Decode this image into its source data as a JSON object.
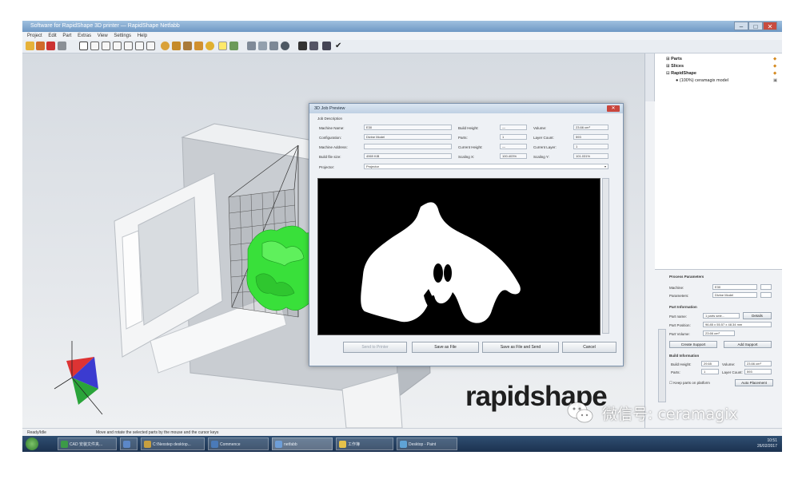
{
  "window": {
    "title": "Software for RapidShape 3D printer — RapidShape Netfabb",
    "menu": [
      "Project",
      "Edit",
      "Part",
      "Extras",
      "View",
      "Settings",
      "Help"
    ]
  },
  "tree": {
    "parts": "Parts",
    "slices": "Slices",
    "machine": "RapidShape",
    "model": "(100%) ceramagix model"
  },
  "process": {
    "header": "Process Parameters",
    "machine_label": "Machine:",
    "machine_value": "E30",
    "params_label": "Parameters:",
    "params_value": "Divine Model",
    "part_info": "Part Information",
    "part_name_label": "Part name:",
    "part_name_value": "1 parts sele...",
    "details_button": "Details",
    "part_position_label": "Part Position:",
    "part_position_value": "96.85 x 55.57 x 48.34 mm",
    "part_volume_label": "Part Volume:",
    "part_volume_value": "23.66 cm³",
    "create_support_button": "Create Support",
    "add_support_button": "Add Support",
    "build_info": "Build Information",
    "build_height_label": "Build Height:",
    "build_height_value": "29.65",
    "volume_label": "Volume:",
    "volume_value": "23.66 cm³",
    "parts_label": "Parts:",
    "parts_value": "1",
    "layer_count_label": "Layer Count:",
    "layer_count_value": "593",
    "keep_parts_label": "Keep parts on platform",
    "auto_placement_button": "Auto Placement"
  },
  "dialog": {
    "title": "3D Job Preview",
    "close": "✕",
    "job_description": "Job Description",
    "machine_name_label": "Machine Name:",
    "machine_name_value": "E30",
    "build_height_label": "Build Height:",
    "build_height_value": "—",
    "volume_label": "Volume:",
    "volume_value": "23.66 cm³",
    "configuration_label": "Configuration:",
    "configuration_value": "Divine Model",
    "parts_label": "Parts:",
    "parts_value": "1",
    "layer_count_label": "Layer Count:",
    "layer_count_value": "593",
    "machine_address_label": "Machine Address:",
    "machine_address_value": "",
    "current_height_label": "Current Height:",
    "current_height_value": "—",
    "current_layer_label": "Current Layer:",
    "current_layer_value": "1",
    "build_file_size_label": "Build file size:",
    "build_file_size_value": "4969 KiB",
    "scaling_x_label": "Scaling X:",
    "scaling_x_value": "100.403%",
    "scaling_y_label": "Scaling Y:",
    "scaling_y_value": "101.031%",
    "projector_label": "Projector:",
    "projector_value": "Projector",
    "buttons": {
      "send": "Send to Printer",
      "save": "Save as File",
      "save_send": "Save as File and Send",
      "cancel": "Cancel"
    }
  },
  "status": {
    "left": "Ready/Idle",
    "hint": "Move and rotate the selected parts by the mouse and the cursor keys"
  },
  "taskbar": {
    "items": [
      {
        "label": "CAD 安装文件夹...",
        "color": "#3c9a47"
      },
      {
        "label": "",
        "color": "#5c87c7"
      },
      {
        "label": "C:\\Nexstep desktop...",
        "color": "#c8a040"
      },
      {
        "label": "Commence",
        "color": "#4a7ab8"
      },
      {
        "label": "netfabb",
        "color": "#6e9ed8"
      },
      {
        "label": "工作簿",
        "color": "#e5c14a"
      },
      {
        "label": "Desktop - Paint",
        "color": "#5fa3d6"
      }
    ],
    "time": "10:51",
    "date": "26/02/2017"
  },
  "brand": "rapidshape",
  "watermark": "微信号: ceramagix"
}
